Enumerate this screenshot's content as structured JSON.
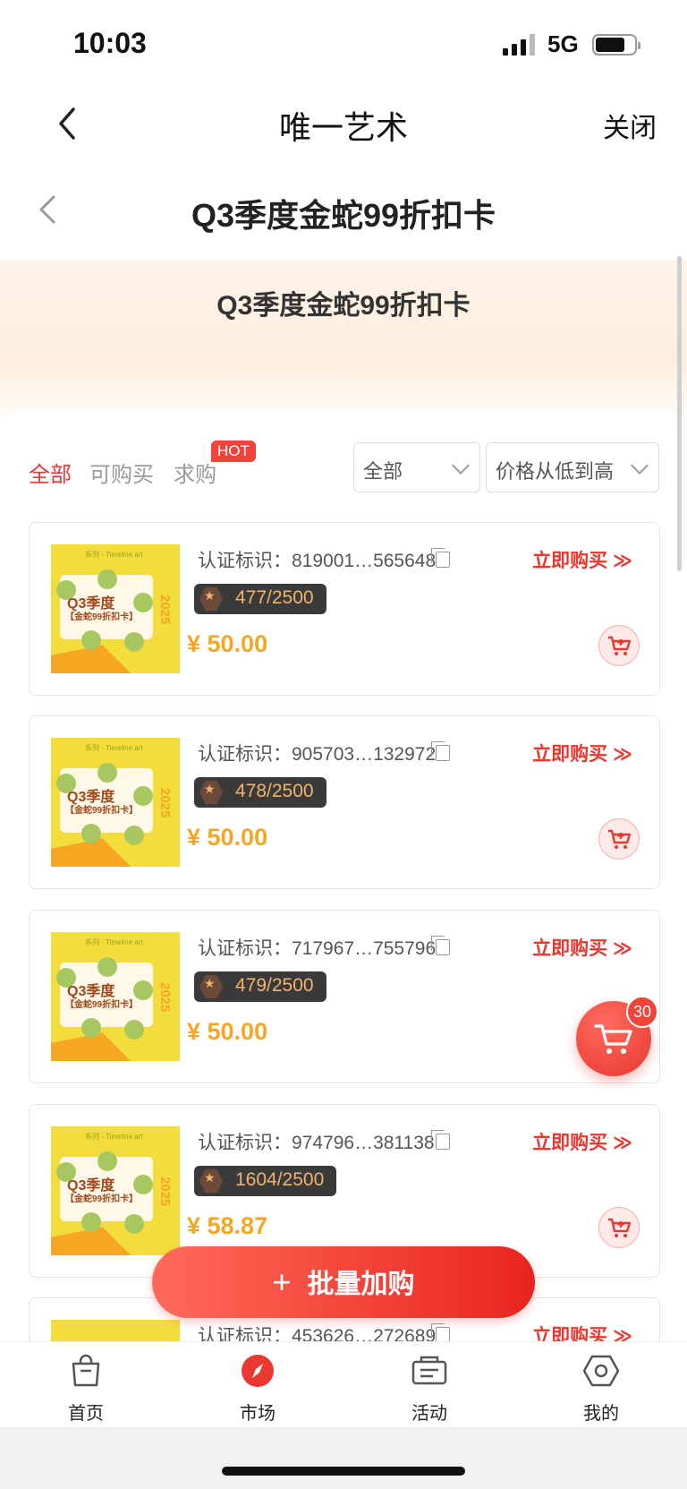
{
  "status_bar": {
    "time": "10:03",
    "network": "5G"
  },
  "nav": {
    "title": "唯一艺术",
    "close_label": "关闭"
  },
  "page": {
    "title": "Q3季度金蛇99折扣卡",
    "banner_title": "Q3季度金蛇99折扣卡"
  },
  "filters": {
    "tabs": [
      "全部",
      "可购买",
      "求购"
    ],
    "hot_badge": "HOT",
    "category_select": "全部",
    "sort_select": "价格从低到高"
  },
  "thumb": {
    "title": "Q3季度",
    "subtitle": "【金蛇99折扣卡】",
    "year": "2025"
  },
  "items": [
    {
      "label": "认证标识：",
      "cert_id": "819001…565648",
      "edition": "477/2500",
      "price": "¥ 50.00",
      "buy_label": "立即购买"
    },
    {
      "label": "认证标识：",
      "cert_id": "905703…132972",
      "edition": "478/2500",
      "price": "¥ 50.00",
      "buy_label": "立即购买"
    },
    {
      "label": "认证标识：",
      "cert_id": "717967…755796",
      "edition": "479/2500",
      "price": "¥ 50.00",
      "buy_label": "立即购买"
    },
    {
      "label": "认证标识：",
      "cert_id": "974796…381138",
      "edition": "1604/2500",
      "price": "¥ 58.87",
      "buy_label": "立即购买"
    },
    {
      "label": "认证标识：",
      "cert_id": "453626…272689",
      "edition": "",
      "price": "",
      "buy_label": "立即购买"
    }
  ],
  "cart": {
    "count": "30"
  },
  "batch_button": {
    "label": "批量加购",
    "plus": "+"
  },
  "tabbar": {
    "items": [
      "首页",
      "市场",
      "活动",
      "我的"
    ],
    "active": "市场"
  },
  "colors": {
    "accent": "#e8382f",
    "price": "#f5a623",
    "edition_bg": "#3a3a3a"
  }
}
